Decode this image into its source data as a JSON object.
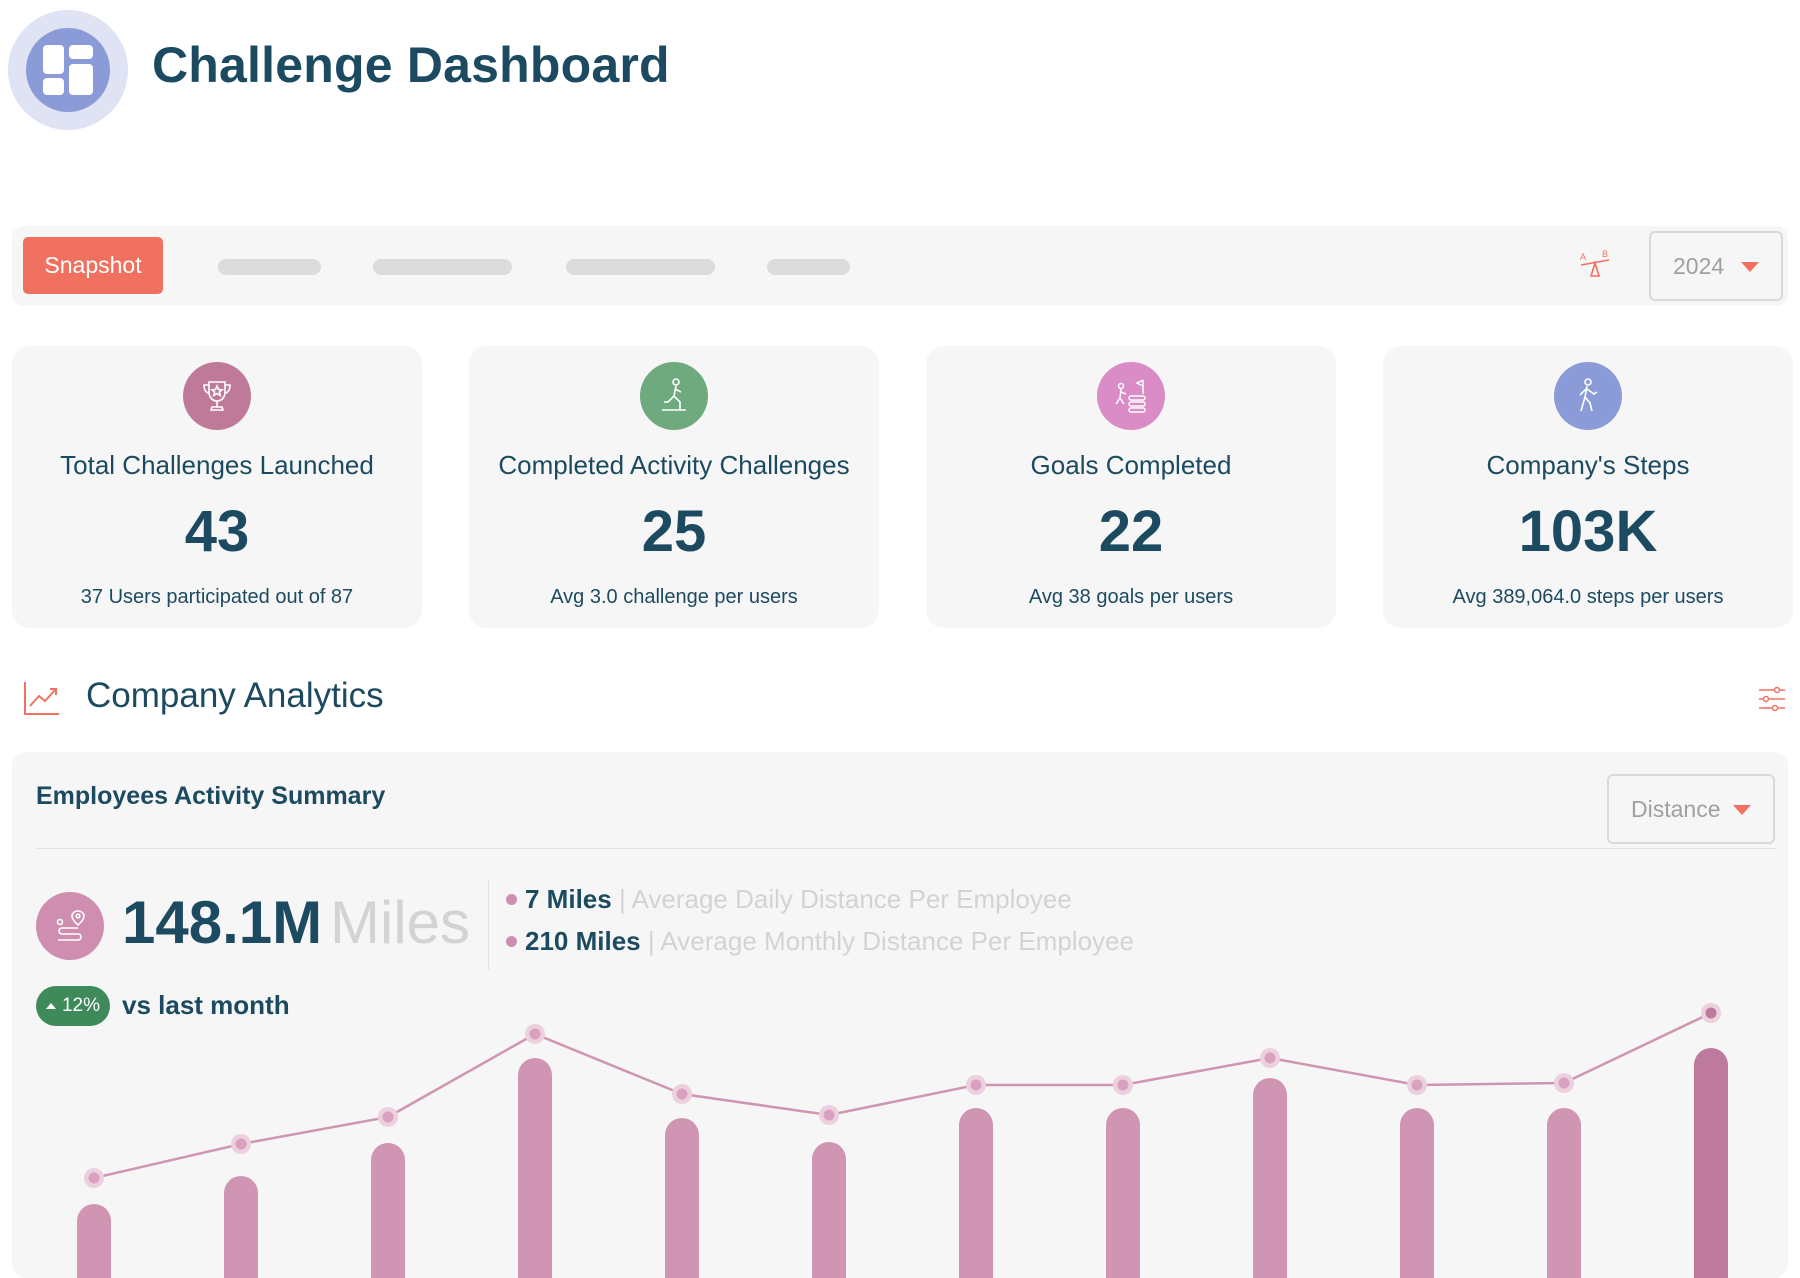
{
  "header": {
    "title": "Challenge Dashboard",
    "logo_icon": "dashboard-grid-icon"
  },
  "tabs": {
    "active_label": "Snapshot",
    "skeleton_count": 4
  },
  "year_filter": {
    "value": "2024"
  },
  "compare_icon": "ab-compare-icon",
  "stats": [
    {
      "title": "Total Challenges Launched",
      "value": "43",
      "sub": "37 Users participated out of 87",
      "icon": "trophy-icon",
      "color": "#bf7a9a"
    },
    {
      "title": "Completed Activity Challenges",
      "value": "25",
      "sub": "Avg 3.0 challenge per users",
      "icon": "runner-icon",
      "color": "#6eaa7e"
    },
    {
      "title": "Goals Completed",
      "value": "22",
      "sub": "Avg 38 goals per users",
      "icon": "goal-flag-icon",
      "color": "#d98cc6"
    },
    {
      "title": "Company's Steps",
      "value": "103K",
      "sub": "Avg 389,064.0 steps per users",
      "icon": "walking-icon",
      "color": "#8b9bd8"
    }
  ],
  "analytics": {
    "title": "Company Analytics"
  },
  "activity": {
    "title": "Employees Activity Summary",
    "metric_select": "Distance",
    "total_value": "148.1M",
    "total_unit": "Miles",
    "daily_value": "7 Miles",
    "daily_label": "| Average Daily Distance Per Employee",
    "monthly_value": "210 Miles",
    "monthly_label": "| Average Monthly Distance Per Employee",
    "trend_badge": "12%",
    "trend_text": "vs last month"
  },
  "chart_data": {
    "type": "bar",
    "note_series": "bars with overlaid trend line; values are relative heights (no axis printed)",
    "series": [
      {
        "values": [
          44,
          72,
          105,
          190,
          130,
          106,
          140,
          140,
          170,
          140,
          140,
          200
        ]
      }
    ],
    "line_values": [
      60,
      94,
      121,
      204,
      144,
      123,
      153,
      153,
      180,
      153,
      155,
      225
    ],
    "colors": {
      "bar": "#cf95b2",
      "bar_last": "#bd7a9d",
      "line": "#cf95b2",
      "point": "#d9a0bf"
    }
  }
}
